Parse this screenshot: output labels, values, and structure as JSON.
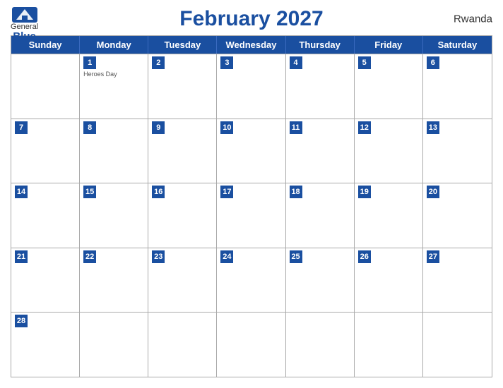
{
  "header": {
    "title": "February 2027",
    "country": "Rwanda",
    "logo": {
      "general": "General",
      "blue": "Blue"
    }
  },
  "dayHeaders": [
    "Sunday",
    "Monday",
    "Tuesday",
    "Wednesday",
    "Thursday",
    "Friday",
    "Saturday"
  ],
  "weeks": [
    [
      {
        "day": "",
        "empty": true
      },
      {
        "day": "1",
        "holiday": "Heroes Day"
      },
      {
        "day": "2"
      },
      {
        "day": "3"
      },
      {
        "day": "4"
      },
      {
        "day": "5"
      },
      {
        "day": "6"
      }
    ],
    [
      {
        "day": "7"
      },
      {
        "day": "8"
      },
      {
        "day": "9"
      },
      {
        "day": "10"
      },
      {
        "day": "11"
      },
      {
        "day": "12"
      },
      {
        "day": "13"
      }
    ],
    [
      {
        "day": "14"
      },
      {
        "day": "15"
      },
      {
        "day": "16"
      },
      {
        "day": "17"
      },
      {
        "day": "18"
      },
      {
        "day": "19"
      },
      {
        "day": "20"
      }
    ],
    [
      {
        "day": "21"
      },
      {
        "day": "22"
      },
      {
        "day": "23"
      },
      {
        "day": "24"
      },
      {
        "day": "25"
      },
      {
        "day": "26"
      },
      {
        "day": "27"
      }
    ],
    [
      {
        "day": "28"
      },
      {
        "day": "",
        "empty": true
      },
      {
        "day": "",
        "empty": true
      },
      {
        "day": "",
        "empty": true
      },
      {
        "day": "",
        "empty": true
      },
      {
        "day": "",
        "empty": true
      },
      {
        "day": "",
        "empty": true
      }
    ]
  ]
}
